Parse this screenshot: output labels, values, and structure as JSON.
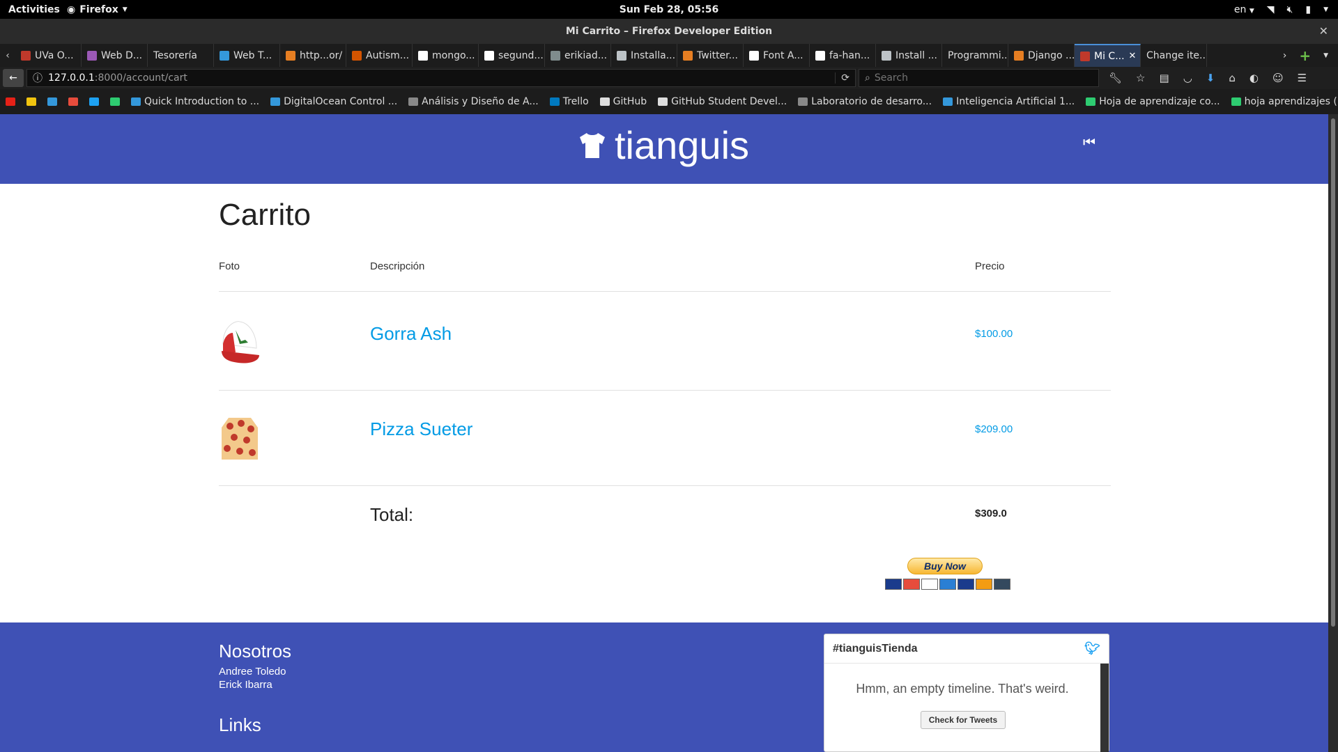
{
  "system_bar": {
    "activities": "Activities",
    "app_name": "Firefox",
    "clock": "Sun Feb 28, 05:56",
    "language": "en"
  },
  "window": {
    "title": "Mi Carrito – Firefox Developer Edition"
  },
  "tabs": [
    {
      "label": "UVa O...",
      "favicon_color": "#c0392b"
    },
    {
      "label": "Web D...",
      "favicon_color": "#9b59b6"
    },
    {
      "label": "Tesorería",
      "favicon_color": ""
    },
    {
      "label": "Web T...",
      "favicon_color": "#3498db"
    },
    {
      "label": "http...or/",
      "favicon_color": "#e67e22"
    },
    {
      "label": "Autism...",
      "favicon_color": "#d35400"
    },
    {
      "label": "mongo...",
      "favicon_color": "#ffffff"
    },
    {
      "label": "segund...",
      "favicon_color": "#ffffff"
    },
    {
      "label": "erikiad...",
      "favicon_color": "#7f8c8d"
    },
    {
      "label": "Installa...",
      "favicon_color": "#bdc3c7"
    },
    {
      "label": "Twitter...",
      "favicon_color": "#e67e22"
    },
    {
      "label": "Font A...",
      "favicon_color": "#ffffff"
    },
    {
      "label": "fa-han...",
      "favicon_color": "#ffffff"
    },
    {
      "label": "Install ...",
      "favicon_color": "#bdc3c7"
    },
    {
      "label": "Programmi...",
      "favicon_color": ""
    },
    {
      "label": "Django ...",
      "favicon_color": "#e67e22"
    },
    {
      "label": "Mi C...",
      "favicon_color": "#c0392b",
      "active": true
    },
    {
      "label": "Change ite...",
      "favicon_color": ""
    }
  ],
  "nav": {
    "url_host": "127.0.0.1",
    "url_path": ":8000/account/cart",
    "search_placeholder": "Search"
  },
  "bookmarks": [
    {
      "label": "",
      "color": "#e62117"
    },
    {
      "label": "",
      "color": "#f1c40f"
    },
    {
      "label": "",
      "color": "#3498db"
    },
    {
      "label": "",
      "color": "#e74c3c"
    },
    {
      "label": "",
      "color": "#1da1f2"
    },
    {
      "label": "",
      "color": "#2ecc71"
    },
    {
      "label": "Quick Introduction to ...",
      "color": "#3498db"
    },
    {
      "label": "DigitalOcean Control ...",
      "color": "#3498db"
    },
    {
      "label": "Análisis y Diseño de A...",
      "color": "#888888"
    },
    {
      "label": "Trello",
      "color": "#0079bf"
    },
    {
      "label": "GitHub",
      "color": "#dddddd"
    },
    {
      "label": "GitHub Student Devel...",
      "color": "#dddddd"
    },
    {
      "label": "Laboratorio de desarro...",
      "color": "#888888"
    },
    {
      "label": "Inteligencia Artificial 1...",
      "color": "#3498db"
    },
    {
      "label": "Hoja de aprendizaje co...",
      "color": "#2ecc71"
    },
    {
      "label": "hoja aprendizajes (indi...",
      "color": "#2ecc71"
    }
  ],
  "site": {
    "brand": "tianguis",
    "brand_color": "#3f51b5",
    "link_color": "#039be5"
  },
  "cart": {
    "title": "Carrito",
    "columns": {
      "photo": "Foto",
      "description": "Descripción",
      "price": "Precio"
    },
    "items": [
      {
        "name": "Gorra Ash",
        "price": "$100.00",
        "image": "cap-image"
      },
      {
        "name": "Pizza Sueter",
        "price": "$209.00",
        "image": "pizza-sweater-image"
      }
    ],
    "total_label": "Total:",
    "total_value": "$309.0",
    "buy_button": "Buy Now"
  },
  "footer": {
    "about_title": "Nosotros",
    "authors": [
      "Andree Toledo",
      "Erick Ibarra"
    ],
    "links_title": "Links",
    "twitter_widget": {
      "title": "#tianguisTienda",
      "message": "Hmm, an empty timeline. That's weird.",
      "button": "Check for Tweets"
    }
  }
}
